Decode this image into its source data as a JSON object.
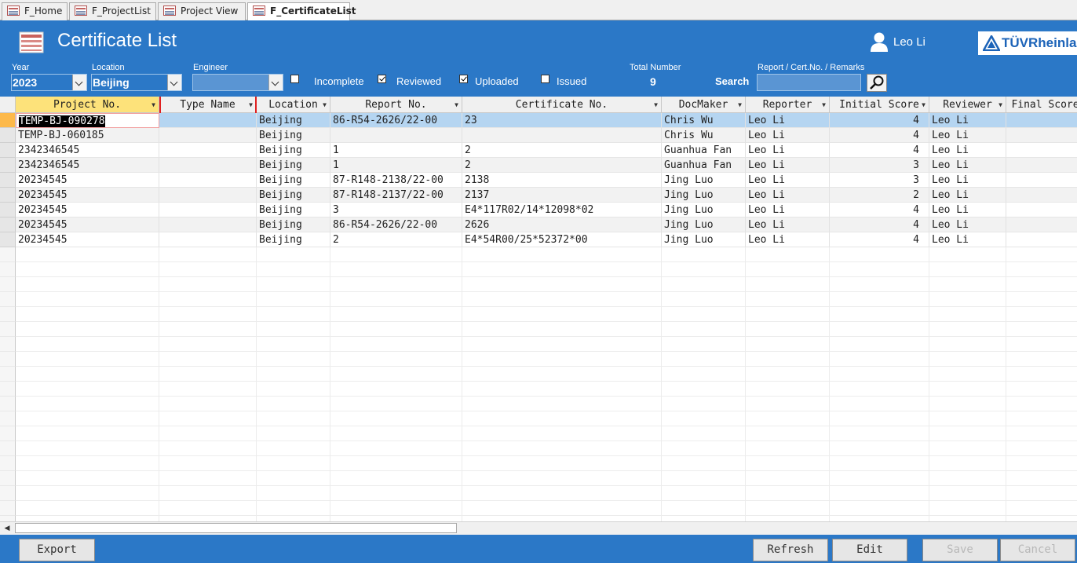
{
  "tabs": [
    {
      "label": "F_Home"
    },
    {
      "label": "F_ProjectList"
    },
    {
      "label": "Project View"
    },
    {
      "label": "F_CertificateList"
    }
  ],
  "header": {
    "title": "Certificate List",
    "user": "Leo Li",
    "logo_text": "TÜVRheinland"
  },
  "filters": {
    "year_label": "Year",
    "year_value": "2023",
    "location_label": "Location",
    "location_value": "Beijing",
    "engineer_label": "Engineer",
    "engineer_value": "",
    "incomplete_label": "Incomplete",
    "reviewed_label": "Reviewed",
    "uploaded_label": "Uploaded",
    "issued_label": "Issued",
    "incomplete_checked": false,
    "reviewed_checked": true,
    "uploaded_checked": true,
    "issued_checked": false,
    "total_label": "Total Number",
    "total_value": "9",
    "search_hint_label": "Report / Cert.No. / Remarks",
    "search_label": "Search",
    "search_value": ""
  },
  "table": {
    "columns": [
      "Project No.",
      "Type Name",
      "Location",
      "Report No.",
      "Certificate No.",
      "DocMaker",
      "Reporter",
      "Initial Score",
      "Reviewer",
      "Final Score"
    ],
    "rows": [
      [
        "TEMP-BJ-090278",
        "",
        "Beijing",
        "86-R54-2626/22-00",
        "23",
        "Chris Wu",
        "Leo Li",
        "4",
        "Leo Li",
        ""
      ],
      [
        "TEMP-BJ-060185",
        "",
        "Beijing",
        "",
        "",
        "Chris Wu",
        "Leo Li",
        "4",
        "Leo Li",
        ""
      ],
      [
        "2342346545",
        "",
        "Beijing",
        "1",
        "2",
        "Guanhua Fan",
        "Leo Li",
        "4",
        "Leo Li",
        ""
      ],
      [
        "2342346545",
        "",
        "Beijing",
        "1",
        "2",
        "Guanhua Fan",
        "Leo Li",
        "3",
        "Leo Li",
        ""
      ],
      [
        "20234545",
        "",
        "Beijing",
        "87-R148-2138/22-00",
        "2138",
        "Jing Luo",
        "Leo Li",
        "3",
        "Leo Li",
        ""
      ],
      [
        "20234545",
        "",
        "Beijing",
        "87-R148-2137/22-00",
        "2137",
        "Jing Luo",
        "Leo Li",
        "2",
        "Leo Li",
        ""
      ],
      [
        "20234545",
        "",
        "Beijing",
        "3",
        "E4*117R02/14*12098*02",
        "Jing Luo",
        "Leo Li",
        "4",
        "Leo Li",
        ""
      ],
      [
        "20234545",
        "",
        "Beijing",
        "86-R54-2626/22-00",
        "2626",
        "Jing Luo",
        "Leo Li",
        "4",
        "Leo Li",
        ""
      ],
      [
        "20234545",
        "",
        "Beijing",
        "2",
        "E4*54R00/25*52372*00",
        "Jing Luo",
        "Leo Li",
        "4",
        "Leo Li",
        ""
      ]
    ]
  },
  "footer": {
    "export_label": "Export",
    "refresh_label": "Refresh",
    "edit_label": "Edit",
    "save_label": "Save",
    "cancel_label": "Cancel"
  },
  "colors": {
    "header_bg": "#2b78c7",
    "selected_row": "#b5d5f1",
    "sorted_column": "#fde27a",
    "highlight_box": "#e02020"
  }
}
